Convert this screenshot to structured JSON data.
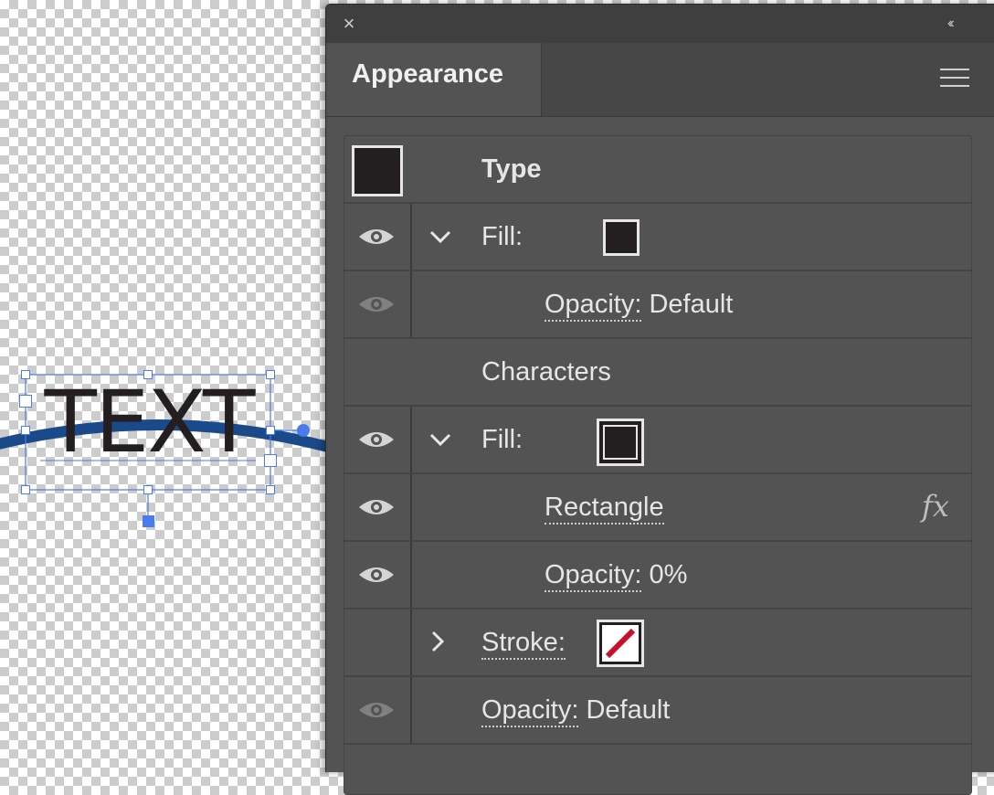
{
  "canvas": {
    "text": "TEXT",
    "selection_color": "#4b7bec",
    "path_color": "#1a4a8a"
  },
  "panel": {
    "close_icon": "×",
    "collapse_icon": "‹‹",
    "tab_title": "Appearance",
    "rows": [
      {
        "label": "Type"
      },
      {
        "label": "Fill:"
      },
      {
        "label": "Opacity:",
        "value": "Default"
      },
      {
        "label": "Characters"
      },
      {
        "label": "Fill:"
      },
      {
        "label": "Rectangle",
        "effect_icon": "fx"
      },
      {
        "label": "Opacity:",
        "value": "0%"
      },
      {
        "label": "Stroke:"
      },
      {
        "label": "Opacity:",
        "value": "Default"
      }
    ]
  },
  "colors": {
    "panel_bg": "#535353",
    "fill_swatch": "#231f20",
    "stroke_none_slash": "#c8102e"
  }
}
